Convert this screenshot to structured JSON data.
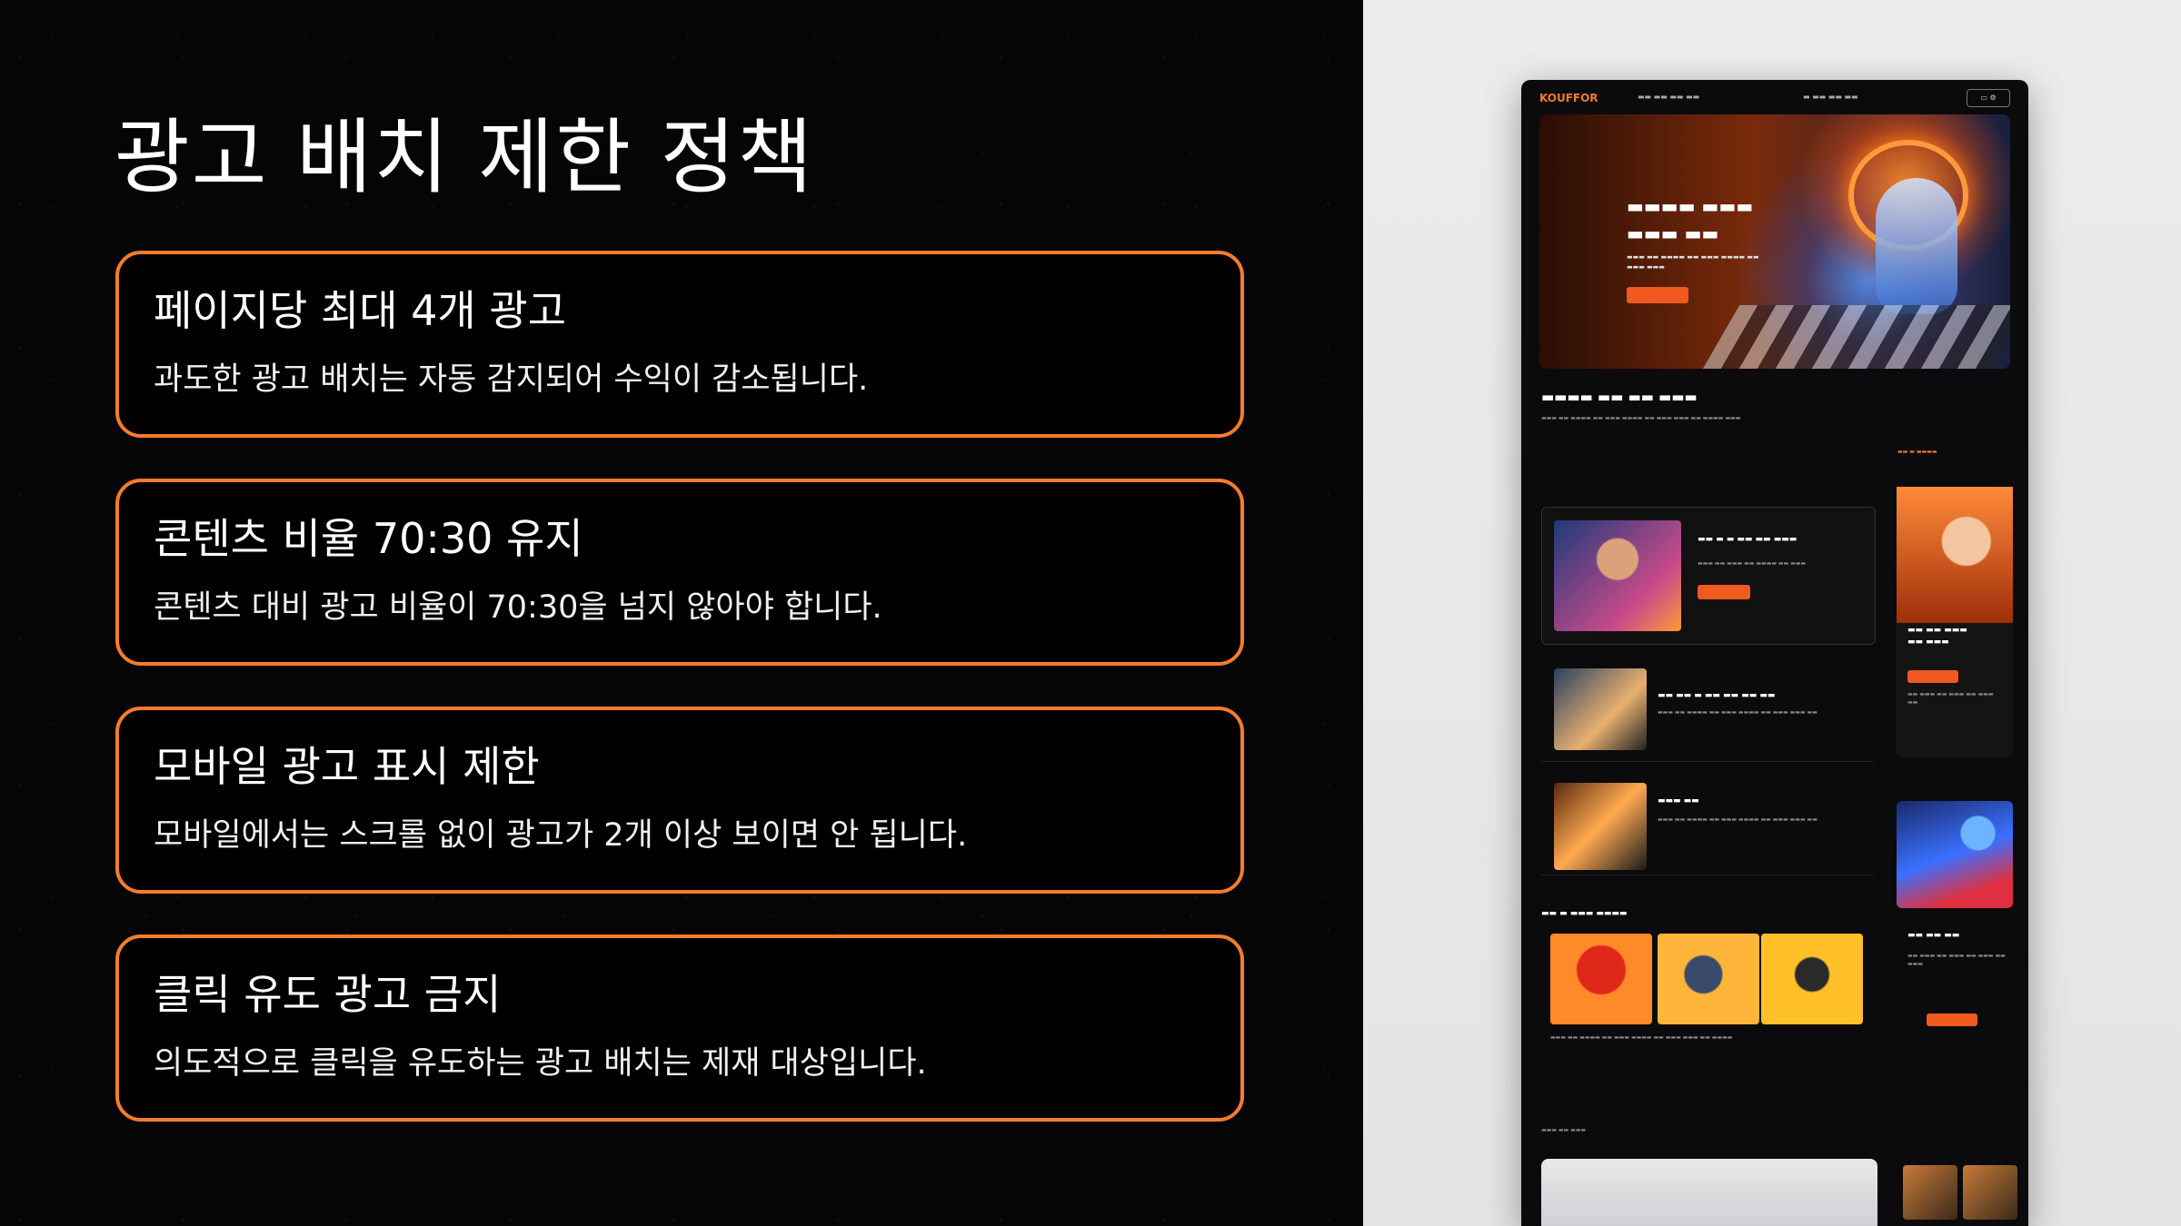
{
  "slide": {
    "title": "광고 배치 제한 정책",
    "rules": [
      {
        "heading": "페이지당 최대 4개 광고",
        "text": "과도한 광고 배치는 자동 감지되어 수익이 감소됩니다."
      },
      {
        "heading": "콘텐츠 비율 70:30 유지",
        "text": "콘텐츠 대비 광고 비율이 70:30을 넘지 않아야 합니다."
      },
      {
        "heading": "모바일 광고 표시 제한",
        "text": "모바일에서는 스크롤 없이 광고가 2개 이상 보이면 안 됩니다."
      },
      {
        "heading": "클릭 유도 광고 금지",
        "text": "의도적으로 클릭을 유도하는 광고 배치는 제재 대상입니다."
      }
    ]
  },
  "mockup": {
    "logo": "KOUFFOR",
    "accent_color": "#f47a2c",
    "card_border_color": "#f57c2d"
  }
}
